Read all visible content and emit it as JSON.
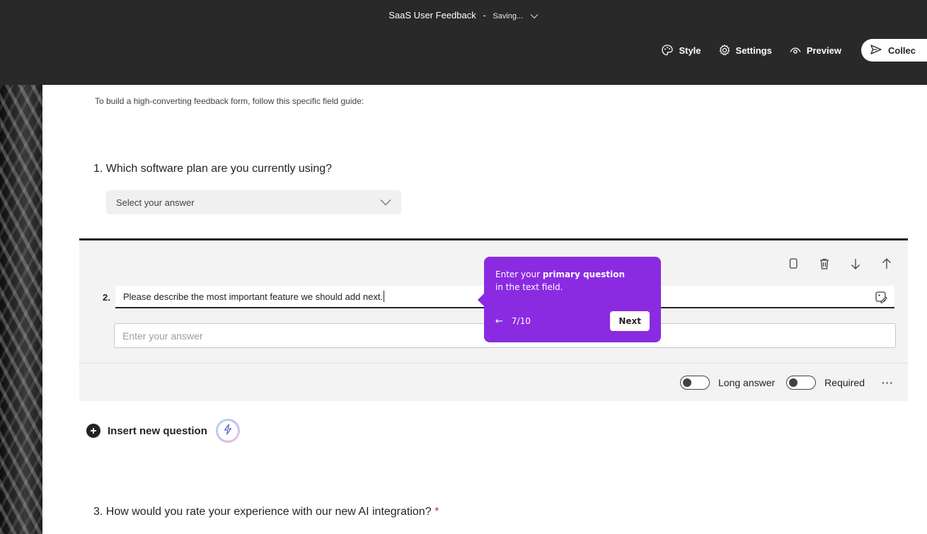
{
  "header": {
    "title": "SaaS User Feedback",
    "separator": "-",
    "status": "Saving...",
    "toolbar": {
      "style_label": "Style",
      "settings_label": "Settings",
      "preview_label": "Preview",
      "collect_label": "Collec"
    }
  },
  "form": {
    "intro": "To build a high-converting feedback form, follow this specific field guide:",
    "questions": [
      {
        "title": "1. Which software plan are you currently using?",
        "select_placeholder": "Select your answer"
      },
      {
        "number": "2.",
        "title": "Please describe the most important feature we should add next.",
        "answer_placeholder": "Enter your answer",
        "long_answer_label": "Long answer",
        "required_label": "Required",
        "more_label": "···"
      },
      {
        "title": "3. How would you rate your experience with our new AI integration?",
        "required_mark": "*"
      }
    ],
    "insert_label": "Insert new question"
  },
  "tooltip": {
    "text_prefix": "Enter your ",
    "text_bold": "primary question",
    "text_suffix": "in the text field.",
    "back_arrow": "←",
    "counter": "7/10",
    "next_label": "Next"
  },
  "colors": {
    "topbar": "#292929",
    "tooltip": "#8a2be2",
    "required": "#c4314b"
  },
  "icons": [
    "chevron-down-icon",
    "palette-icon",
    "gear-icon",
    "eye-icon",
    "send-icon",
    "copy-icon",
    "trash-icon",
    "arrow-down-icon",
    "arrow-up-icon",
    "image-edit-icon",
    "plus-circle-icon",
    "lightning-icon"
  ]
}
